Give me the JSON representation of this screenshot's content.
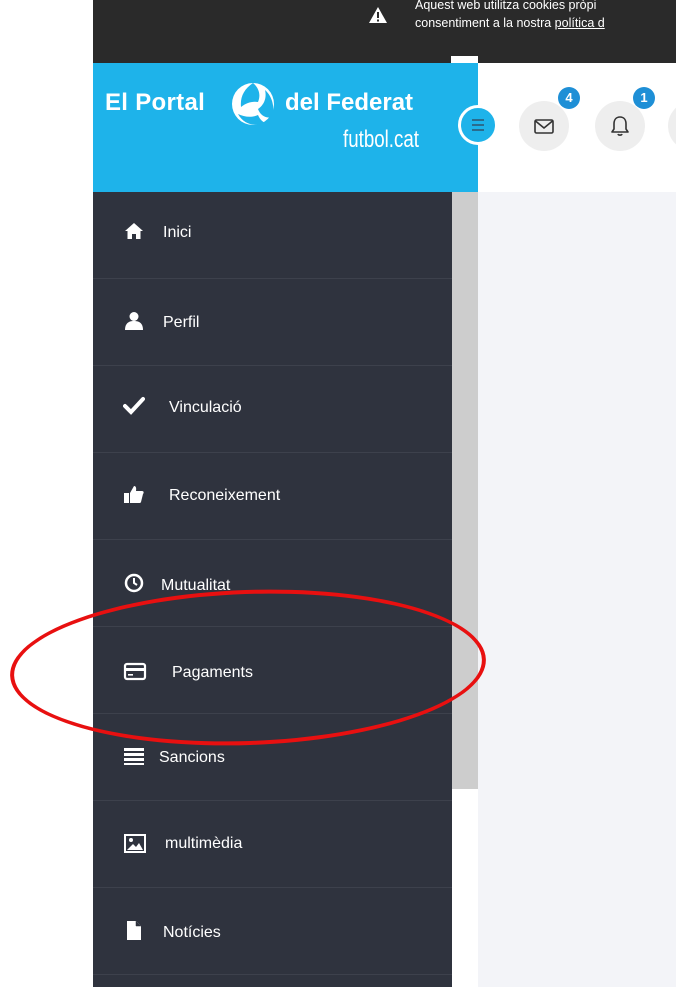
{
  "cookie_banner": {
    "line1": "Aquest web utilitza cookies pròpi",
    "line2_prefix": "consentiment a la nostra ",
    "link_text": "política d"
  },
  "logo": {
    "part1": "El Portal",
    "part2": "del Federat",
    "subtitle": "futbol.cat"
  },
  "header": {
    "messages_badge": "4",
    "notifications_badge": "1"
  },
  "sidebar": {
    "items": [
      {
        "label": "Inici",
        "icon": "home-icon"
      },
      {
        "label": "Perfil",
        "icon": "user-icon"
      },
      {
        "label": "Vinculació",
        "icon": "check-icon"
      },
      {
        "label": "Reconeixement",
        "icon": "thumbs-up-icon"
      },
      {
        "label": "Mutualitat",
        "icon": "clock-icon"
      },
      {
        "label": "Pagaments",
        "icon": "credit-card-icon"
      },
      {
        "label": "Sancions",
        "icon": "list-icon"
      },
      {
        "label": "multimèdia",
        "icon": "image-icon"
      },
      {
        "label": "Notícies",
        "icon": "document-icon"
      }
    ]
  },
  "colors": {
    "brand": "#1eb3ea",
    "sidebar_bg": "#2f333e",
    "badge": "#1e8fd6",
    "annotation": "#e81010"
  }
}
